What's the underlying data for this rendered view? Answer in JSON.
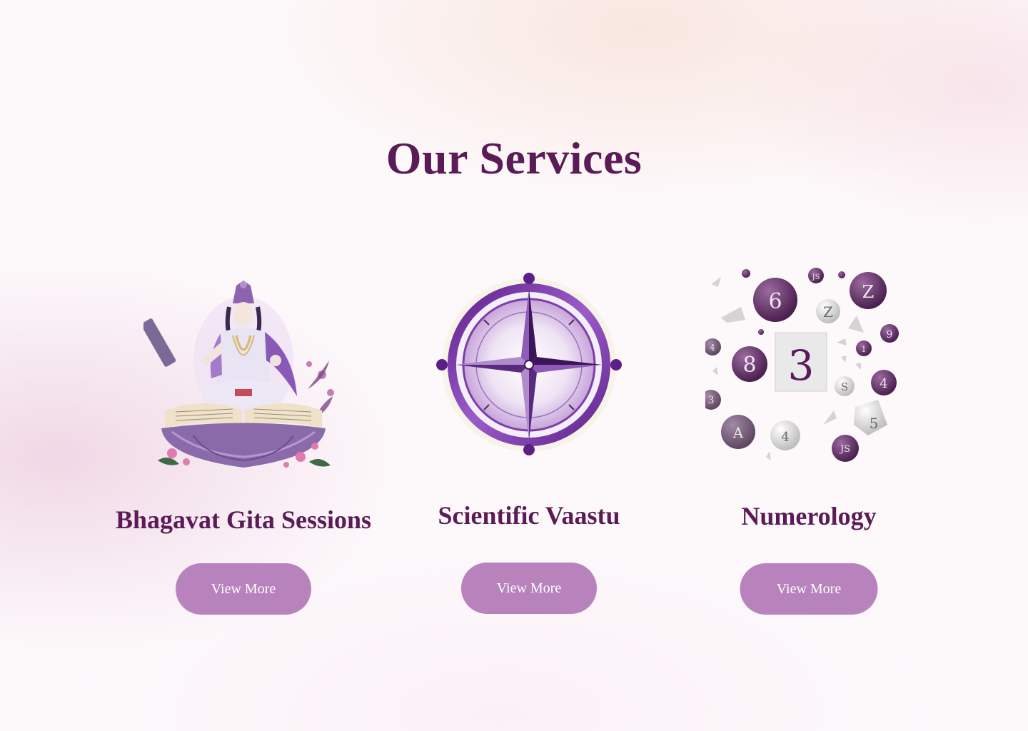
{
  "section": {
    "title": "Our Services"
  },
  "services": [
    {
      "name": "Bhagavat Gita Sessions",
      "button": "View More",
      "icon": "krishna-on-lotus-book-illustration"
    },
    {
      "name": "Scientific Vaastu",
      "button": "View More",
      "icon": "compass-illustration"
    },
    {
      "name": "Numerology",
      "button": "View More",
      "icon": "floating-numbers-illustration"
    }
  ],
  "numerology_balls": [
    "6",
    "JS",
    "Z",
    "Z",
    "9",
    "4",
    "8",
    "3",
    "1",
    "4",
    "3",
    "5",
    "A",
    "4",
    "5",
    "JS"
  ],
  "colors": {
    "title": "#5a1b57",
    "button": "#b883bd",
    "accent": "#6d2e86"
  }
}
